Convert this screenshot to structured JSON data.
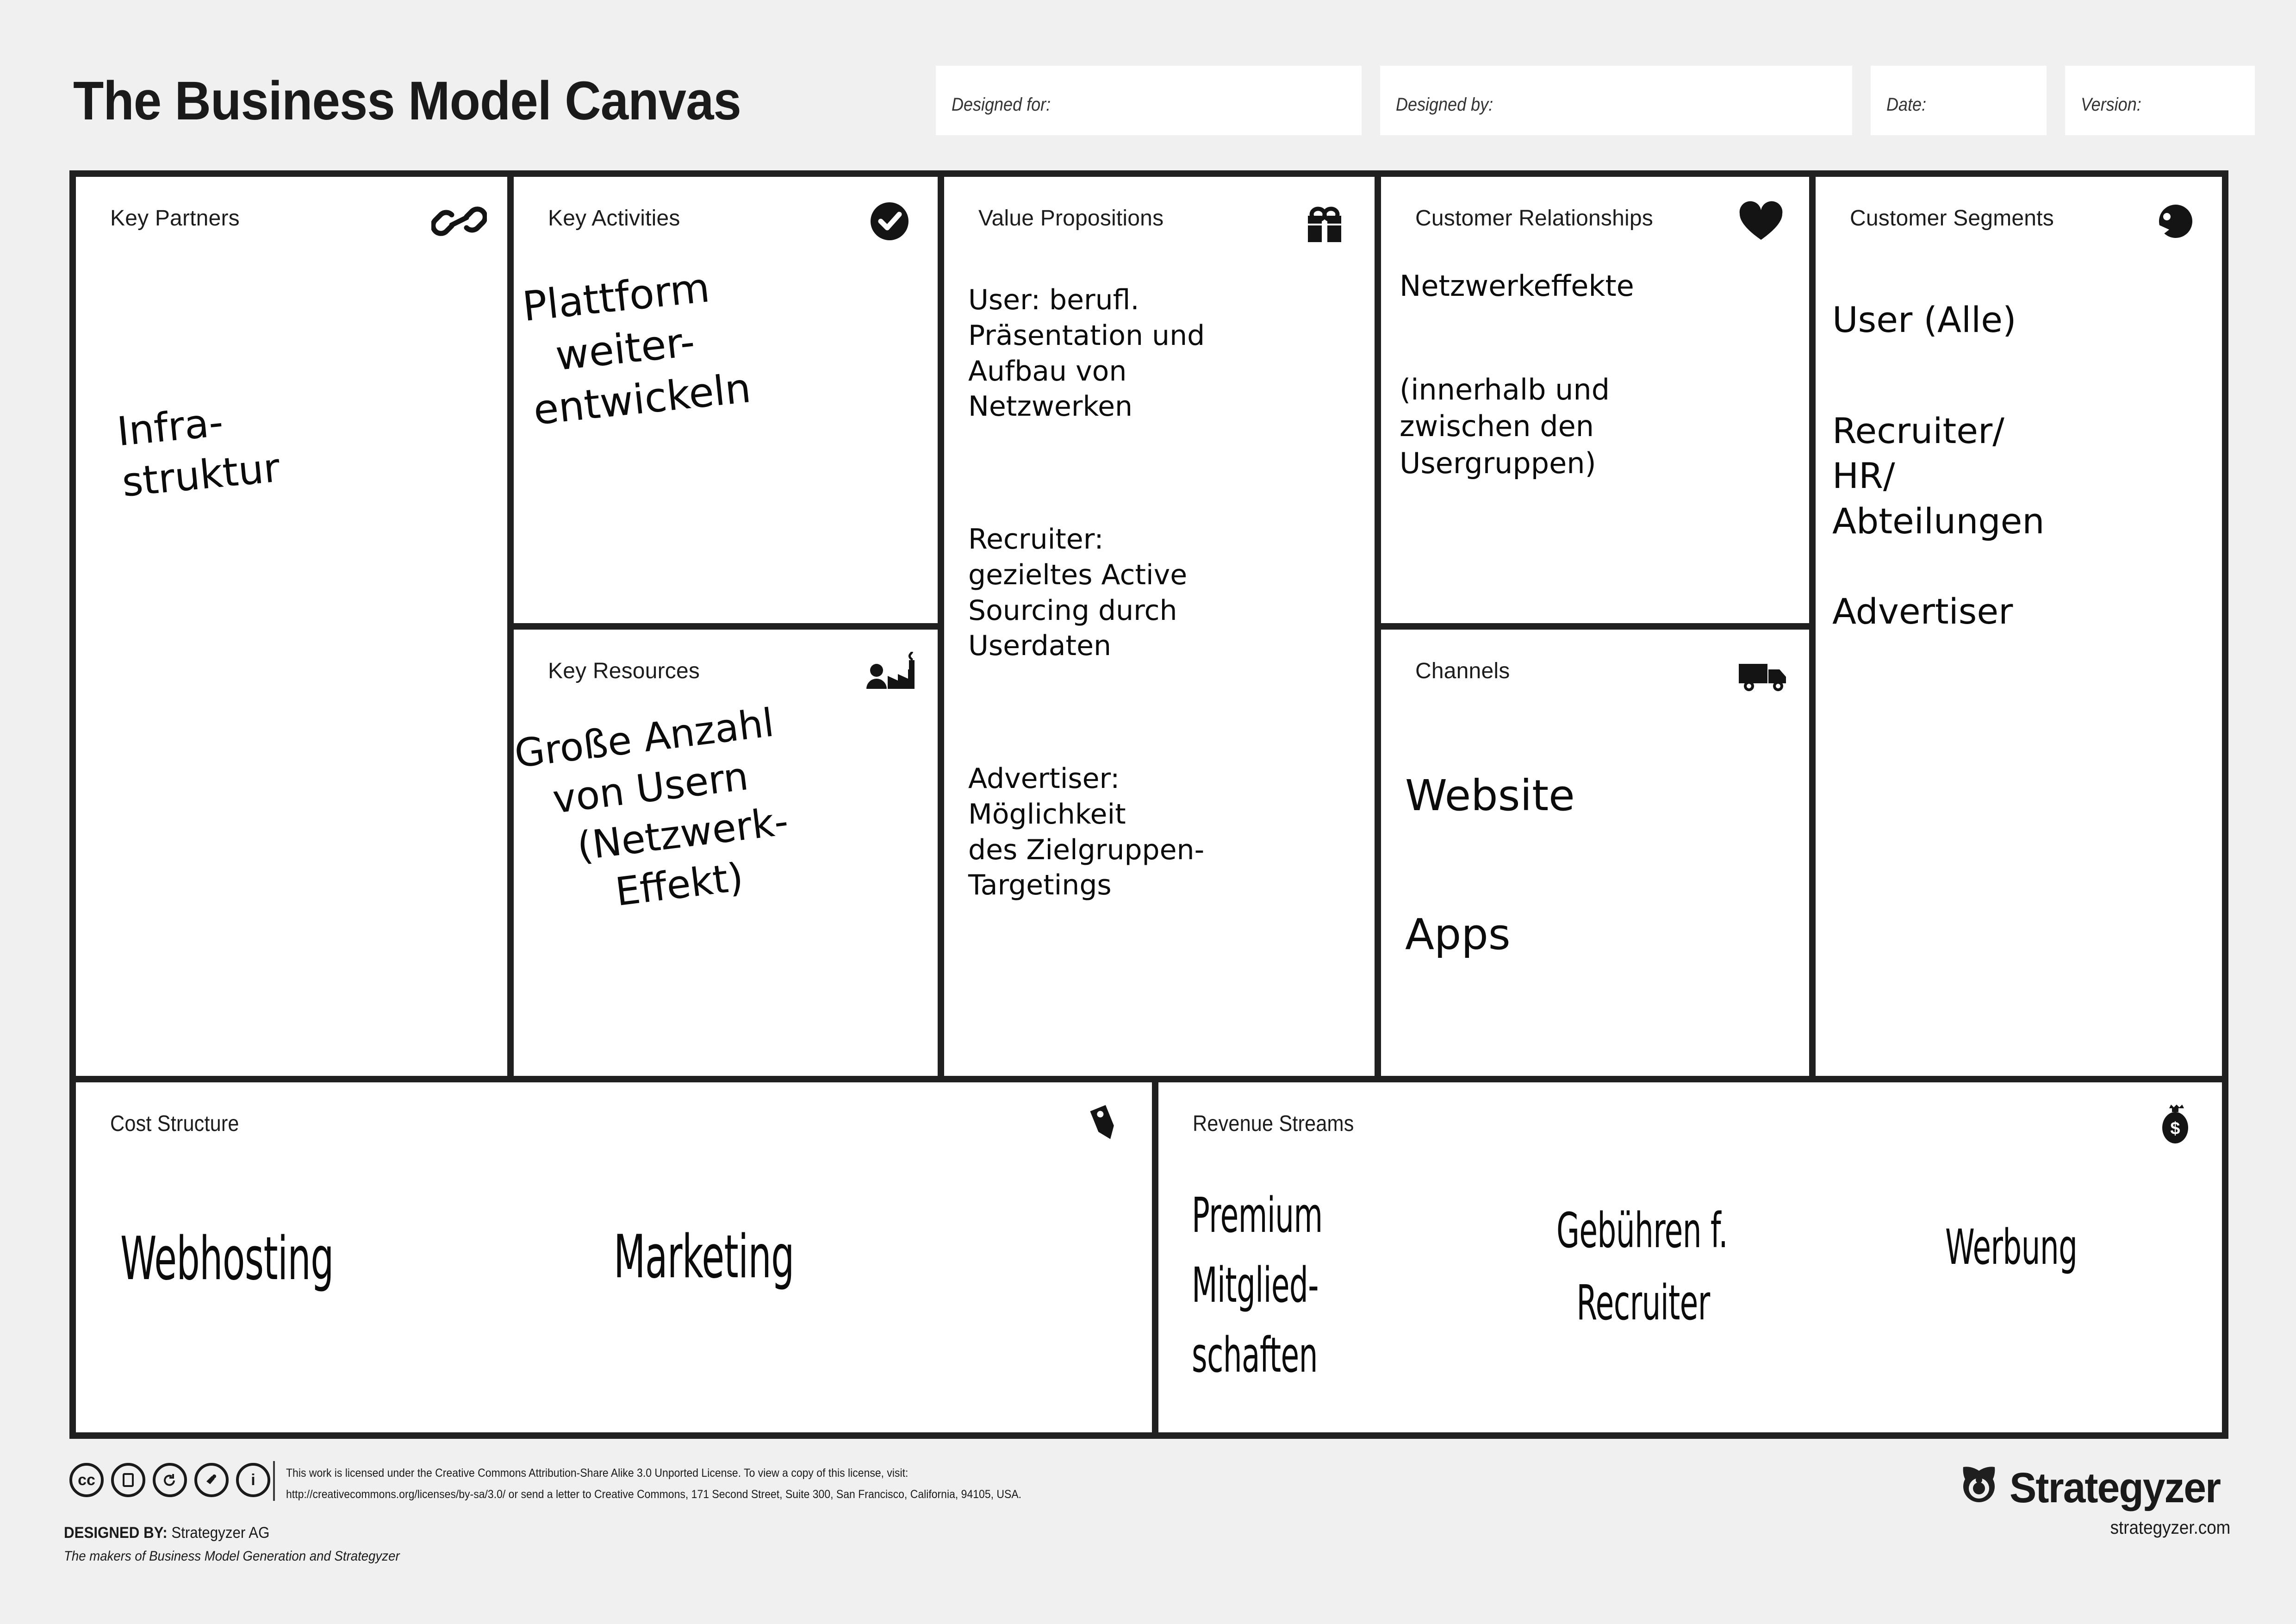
{
  "header": {
    "title": "The Business Model Canvas",
    "fields": [
      {
        "label": "Designed for:",
        "value": ""
      },
      {
        "label": "Designed by:",
        "value": ""
      },
      {
        "label": "Date:",
        "value": ""
      },
      {
        "label": "Version:",
        "value": ""
      }
    ]
  },
  "blocks": {
    "key_partners": {
      "title": "Key Partners",
      "icon": "chain-link-icon",
      "notes": [
        {
          "lines": [
            "Infra-",
            "struktur"
          ]
        }
      ]
    },
    "key_activities": {
      "title": "Key Activities",
      "icon": "check-circle-icon",
      "notes": [
        {
          "lines": [
            "Plattform",
            "weiter-",
            "entwickeln"
          ]
        }
      ]
    },
    "key_resources": {
      "title": "Key Resources",
      "icon": "factory-worker-icon",
      "notes": [
        {
          "lines": [
            "Große Anzahl",
            "von Usern",
            "(Netzwerk-",
            "Effekt)"
          ]
        }
      ]
    },
    "value_propositions": {
      "title": "Value Propositions",
      "icon": "gift-icon",
      "notes": [
        {
          "lines": [
            "User: berufl.",
            "Präsentation und",
            "Aufbau von",
            "Netzwerken"
          ]
        },
        {
          "lines": [
            "Recruiter:",
            "gezieltes Active",
            "Sourcing durch",
            "Userdaten"
          ]
        },
        {
          "lines": [
            "Advertiser:",
            "Möglichkeit",
            "des Zielgruppen-",
            "Targetings"
          ]
        }
      ]
    },
    "customer_relationships": {
      "title": "Customer Relationships",
      "icon": "heart-icon",
      "notes": [
        {
          "lines": [
            "Netzwerkeffekte"
          ]
        },
        {
          "lines": [
            "(innerhalb und",
            "zwischen den",
            "Usergruppen)"
          ]
        }
      ]
    },
    "channels": {
      "title": "Channels",
      "icon": "delivery-truck-icon",
      "notes": [
        {
          "lines": [
            "Website"
          ]
        },
        {
          "lines": [
            "Apps"
          ]
        }
      ]
    },
    "customer_segments": {
      "title": "Customer Segments",
      "icon": "customer-head-icon",
      "notes": [
        {
          "lines": [
            "User (Alle)"
          ]
        },
        {
          "lines": [
            "Recruiter/",
            "HR/",
            "Abteilungen"
          ]
        },
        {
          "lines": [
            "Advertiser"
          ]
        }
      ]
    },
    "cost_structure": {
      "title": "Cost Structure",
      "icon": "price-tag-icon",
      "notes": [
        {
          "lines": [
            "Webhosting"
          ]
        },
        {
          "lines": [
            "Marketing"
          ]
        }
      ]
    },
    "revenue_streams": {
      "title": "Revenue Streams",
      "icon": "money-bag-icon",
      "notes": [
        {
          "lines": [
            "Premium",
            "Mitglied-",
            "schaften"
          ]
        },
        {
          "lines": [
            "Gebühren f.",
            "Recruiter"
          ]
        },
        {
          "lines": [
            "Werbung"
          ]
        }
      ]
    }
  },
  "footer": {
    "cc_badges": [
      "cc",
      "by",
      "sa",
      "nc",
      "info"
    ],
    "license_line_1": "This work is licensed under the Creative Commons Attribution-Share Alike 3.0 Unported License. To view a copy of this license, visit:",
    "license_line_2": "http://creativecommons.org/licenses/by-sa/3.0/ or send a letter to Creative Commons, 171 Second Street, Suite 300, San Francisco, California, 94105, USA.",
    "designed_by_label": "DESIGNED BY:",
    "designed_by_value": "Strategyzer AG",
    "makers_line": "The makers of Business Model Generation and Strategyzer",
    "brand_name": "Strategyzer",
    "brand_url": "strategyzer.com"
  },
  "colors": {
    "page_bg": "#f0f0f0",
    "grid_border": "#202020",
    "cell_bg": "#ffffff",
    "ink": "#0b0b0b"
  }
}
